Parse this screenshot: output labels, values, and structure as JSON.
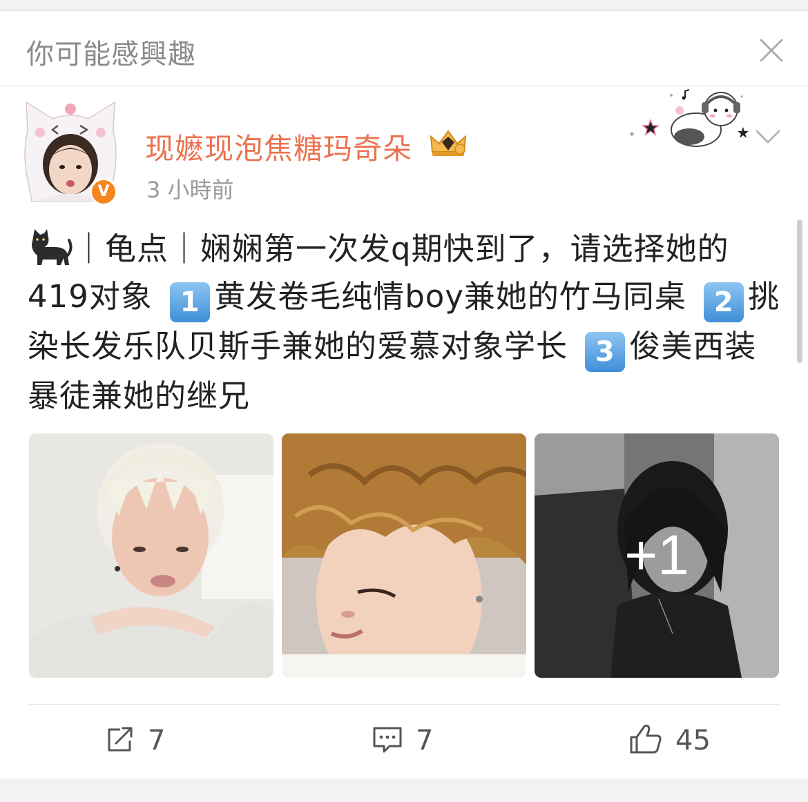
{
  "recommend": {
    "title": "你可能感興趣"
  },
  "post": {
    "username": "现嬷现泡焦糖玛奇朵",
    "timestamp": "3 小時前",
    "verified_badge": "V",
    "text": {
      "cat_emoji": "black-cat",
      "p1": "｜龟点｜娴娴第一次发q期快到了，请选择她的 419对象 ",
      "k1": "1",
      "p2": "黄发卷毛纯情boy兼她的竹马同桌 ",
      "k2": "2",
      "p3": "挑染长发乐队贝斯手兼她的爱慕对象学长 ",
      "k3": "3",
      "p4": "俊美西装暴徒兼她的继兄"
    },
    "images": [
      {
        "name": "photo-blonde-hair"
      },
      {
        "name": "photo-curly-brown-hair"
      },
      {
        "name": "photo-black-long-hair",
        "more": "+1"
      }
    ]
  },
  "actions": {
    "share_count": "7",
    "comment_count": "7",
    "like_count": "45"
  },
  "colors": {
    "username": "#eb7350",
    "badge": "#f68520",
    "muted": "#999999"
  }
}
